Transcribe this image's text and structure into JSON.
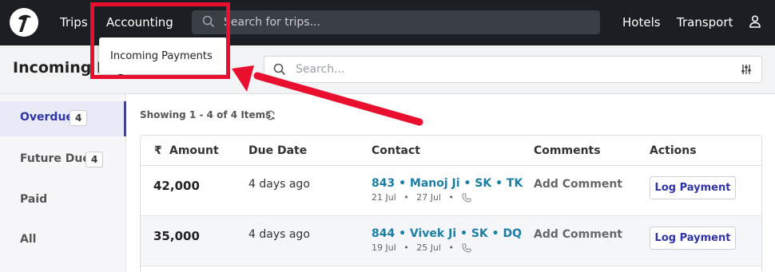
{
  "nav": {
    "trips": "Trips",
    "accounting": "Accounting",
    "search_placeholder": "Search for trips...",
    "hotels": "Hotels",
    "transport": "Transport"
  },
  "dropdown": {
    "item": "Incoming Payments"
  },
  "page": {
    "title": "Incoming Payments",
    "search_placeholder": "Search..."
  },
  "sidebar": {
    "items": [
      {
        "label": "Overdue",
        "badge": "4"
      },
      {
        "label": "Future Due",
        "badge": "4"
      },
      {
        "label": "Paid"
      },
      {
        "label": "All"
      }
    ]
  },
  "list": {
    "showing": "Showing 1 - 4 of 4 Items",
    "headers": {
      "currency": "₹",
      "amount": "Amount",
      "due_date": "Due Date",
      "contact": "Contact",
      "comments": "Comments",
      "actions": "Actions"
    },
    "rows": [
      {
        "amount": "42,000",
        "due": "4 days ago",
        "contact": "843 • Manoj Ji • SK • TK",
        "from": "21 Jul",
        "to": "27 Jul",
        "comment": "Add Comment",
        "action": "Log Payment"
      },
      {
        "amount": "35,000",
        "due": "4 days ago",
        "contact": "844 • Vivek Ji • SK • DQ",
        "from": "19 Jul",
        "to": "25 Jul",
        "comment": "Add Comment",
        "action": "Log Payment"
      }
    ],
    "separator": "•"
  },
  "colors": {
    "nav_bg": "#1b1f24",
    "accent": "#2f34a8",
    "contact_link": "#1a7fa3",
    "annotation": "#e8102e"
  }
}
